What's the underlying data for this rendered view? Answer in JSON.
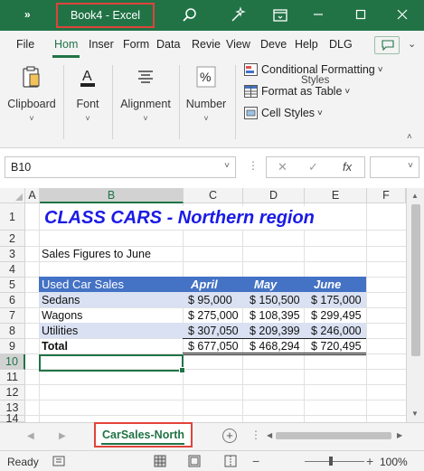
{
  "window": {
    "title": "Book4  -  Excel",
    "quick_access": "»",
    "brand_color": "#217346",
    "highlight_color": "#e0433a"
  },
  "tabs": [
    {
      "label": "File"
    },
    {
      "label": "Hom",
      "active": true
    },
    {
      "label": "Inser"
    },
    {
      "label": "Form"
    },
    {
      "label": "Data"
    },
    {
      "label": "Revie"
    },
    {
      "label": "View"
    },
    {
      "label": "Deve"
    },
    {
      "label": "Help"
    },
    {
      "label": "DLG"
    }
  ],
  "ribbon": {
    "groups": [
      {
        "label": "Clipboard",
        "icon": "clipboard-icon"
      },
      {
        "label": "Font",
        "icon": "font-color-icon"
      },
      {
        "label": "Alignment",
        "icon": "align-icon"
      },
      {
        "label": "Number",
        "icon": "percent-icon"
      }
    ],
    "styles": {
      "items": [
        {
          "label": "Conditional Formatting",
          "chevron": "˅"
        },
        {
          "label": "Format as Table",
          "chevron": "˅"
        },
        {
          "label": "Cell Styles",
          "chevron": "˅"
        }
      ],
      "group_label": "Styles"
    }
  },
  "formula_bar": {
    "name_box": "B10",
    "cancel_symbol": "✕",
    "enter_symbol": "✓",
    "fx_symbol": "fx",
    "formula": ""
  },
  "grid": {
    "columns": [
      "A",
      "B",
      "C",
      "D",
      "E",
      "F"
    ],
    "selected_column": "B",
    "rows": [
      "1",
      "2",
      "3",
      "4",
      "5",
      "6",
      "7",
      "8",
      "9",
      "10",
      "11",
      "12",
      "13",
      "14"
    ],
    "selected_row": "10",
    "title": "CLASS CARS - Northern region",
    "subtitle": "Sales Figures to June",
    "table": {
      "header": {
        "label": "Used Car Sales",
        "months": [
          "April",
          "May",
          "June"
        ]
      },
      "rows": [
        {
          "label": "Sedans",
          "values": [
            "$   95,000",
            "$ 150,500",
            "$ 175,000"
          ]
        },
        {
          "label": "Wagons",
          "values": [
            "$ 275,000",
            "$ 108,395",
            "$ 299,495"
          ]
        },
        {
          "label": "Utilities",
          "values": [
            "$ 307,050",
            "$ 209,399",
            "$ 246,000"
          ]
        }
      ],
      "total": {
        "label": "Total",
        "values": [
          "$ 677,050",
          "$ 468,294",
          "$ 720,495"
        ]
      },
      "header_color": "#4472c4",
      "band_color": "#d9e1f2",
      "title_color": "#1a1ae6"
    }
  },
  "sheets": {
    "active": "CarSales-North",
    "add_symbol": "+",
    "more_symbol": "⋮"
  },
  "status": {
    "ready": "Ready",
    "zoom": "100%",
    "zoom_level": 1.0
  }
}
